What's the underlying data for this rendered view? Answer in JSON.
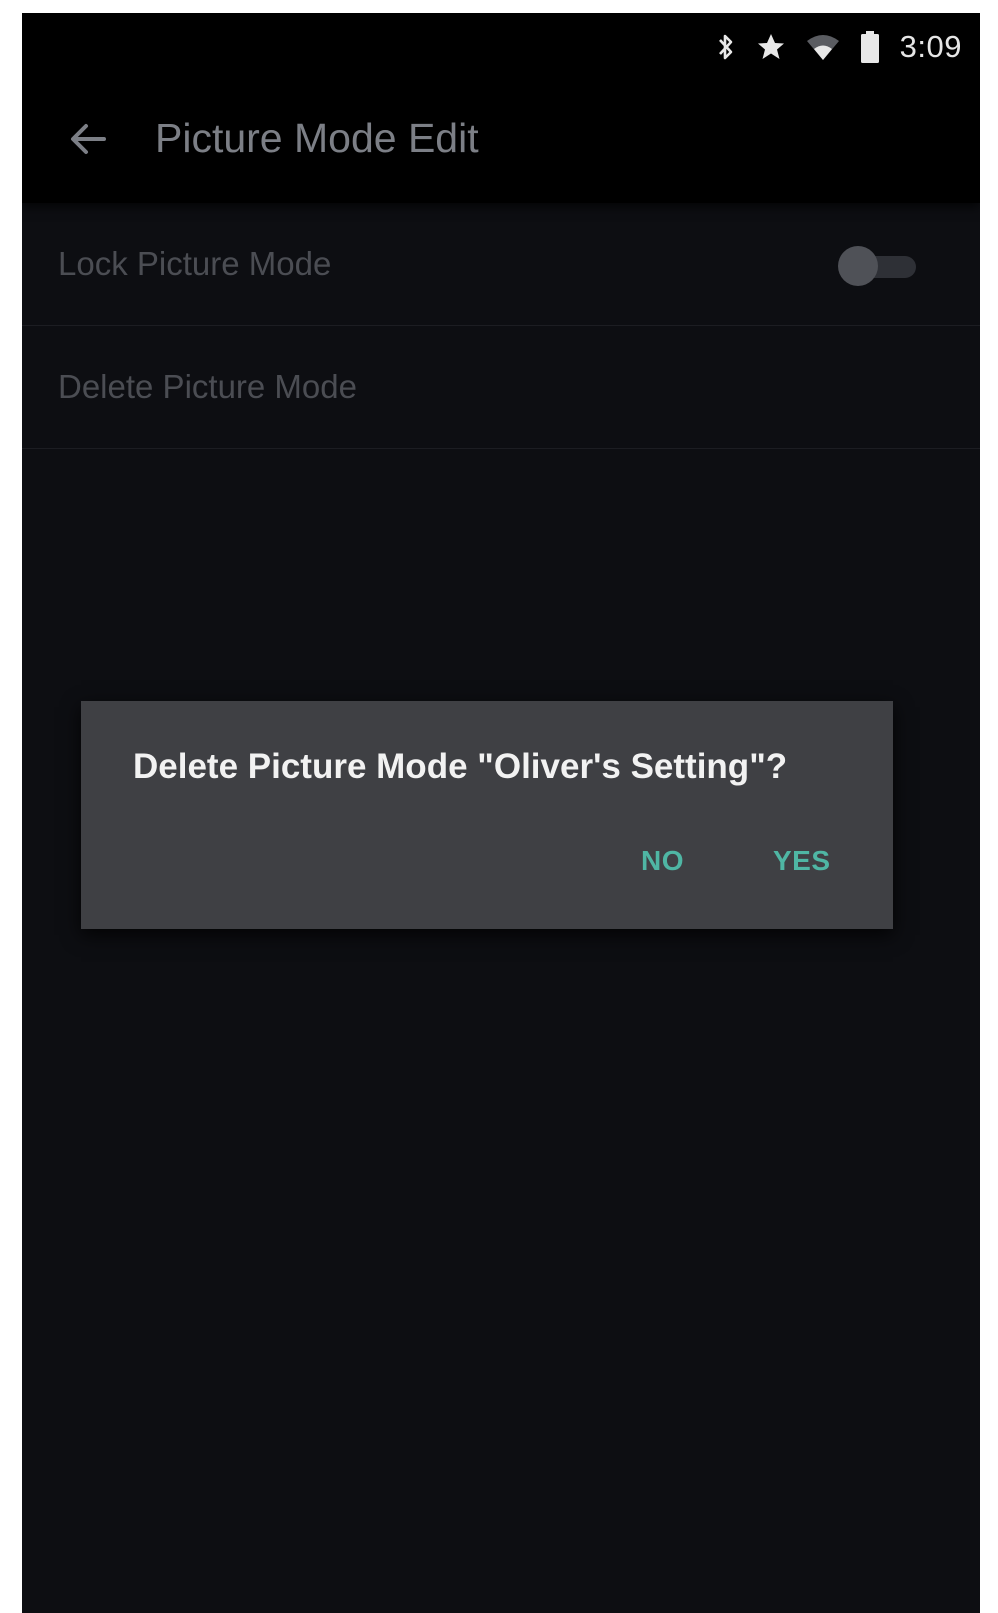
{
  "status_bar": {
    "time": "3:09",
    "icons": [
      "bluetooth-icon",
      "star-icon",
      "wifi-icon",
      "battery-icon"
    ]
  },
  "app_bar": {
    "back_icon": "arrow-left-icon",
    "title": "Picture Mode Edit"
  },
  "settings": {
    "items": [
      {
        "label": "Lock Picture Mode",
        "control": "toggle",
        "on": false
      },
      {
        "label": "Delete Picture Mode"
      }
    ]
  },
  "dialog": {
    "message": "Delete Picture Mode \"Oliver's Setting\"?",
    "no_label": "NO",
    "yes_label": "YES",
    "accent_color": "#4fb6a4"
  },
  "colors": {
    "background": "#0d0e12",
    "app_bar": "#000000",
    "dialog_bg": "#3f4044"
  }
}
